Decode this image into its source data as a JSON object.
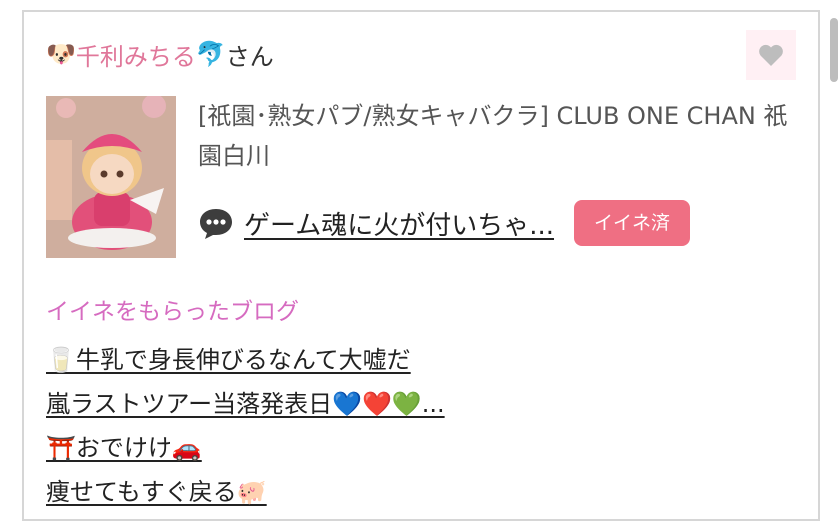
{
  "user": {
    "prefix_emoji": "🐶",
    "name": "千利みちる",
    "name_emoji": "🐬",
    "suffix": "さん"
  },
  "heart_button": {
    "icon": "heart-icon",
    "color": "#bdbdbd",
    "bg": "#fff0f4"
  },
  "shop": {
    "name": "[祇園･熟女パブ/熟女キャバクラ]  CLUB ONE CHAN 祇園白川"
  },
  "latest_post": {
    "icon": "speech-bubble-icon",
    "title": "ゲーム魂に火が付いちゃ...",
    "button_label": "イイネ済",
    "button_color": "#ef6f83"
  },
  "liked_blogs": {
    "title": "イイネをもらったブログ",
    "title_color": "#d66bc0",
    "items": [
      "🥛牛乳で身長伸びるなんて大嘘だ",
      "嵐ラストツアー当落発表日💙❤️💚...",
      "⛩️おでけけ🚗",
      "痩せてもすぐ戻る🐖"
    ]
  }
}
